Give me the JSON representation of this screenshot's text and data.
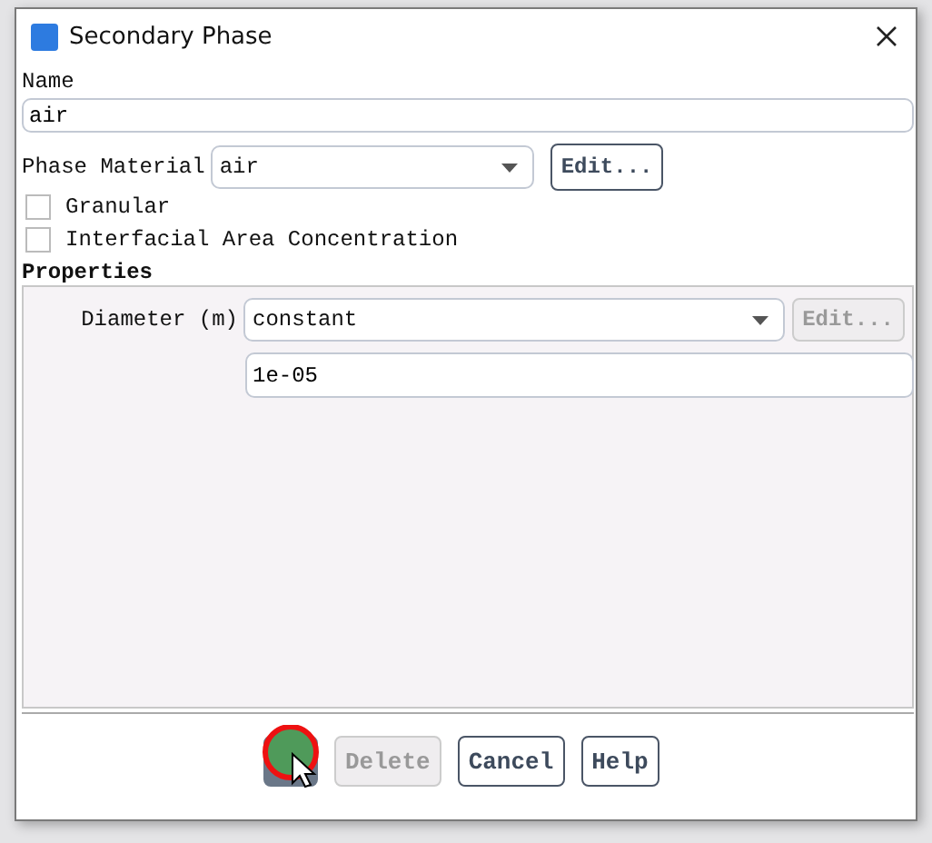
{
  "window": {
    "title": "Secondary Phase"
  },
  "name": {
    "label": "Name",
    "value": "air"
  },
  "phase_material": {
    "label": "Phase Material",
    "value": "air",
    "edit": {
      "label": "Edit...",
      "disabled": false
    }
  },
  "options": [
    {
      "label": "Granular",
      "checked": false
    },
    {
      "label": "Interfacial Area Concentration",
      "checked": false
    }
  ],
  "properties": {
    "title": "Properties",
    "diameter": {
      "label": "Diameter (m)",
      "method": "constant",
      "edit": {
        "label": "Edit...",
        "disabled": true
      },
      "value": "1e-05"
    }
  },
  "ok_button": {
    "click_marker": true
  },
  "buttons": [
    {
      "label": "Delete",
      "disabled": true
    },
    {
      "label": "Cancel",
      "disabled": false
    },
    {
      "label": "Help",
      "disabled": false
    }
  ]
}
